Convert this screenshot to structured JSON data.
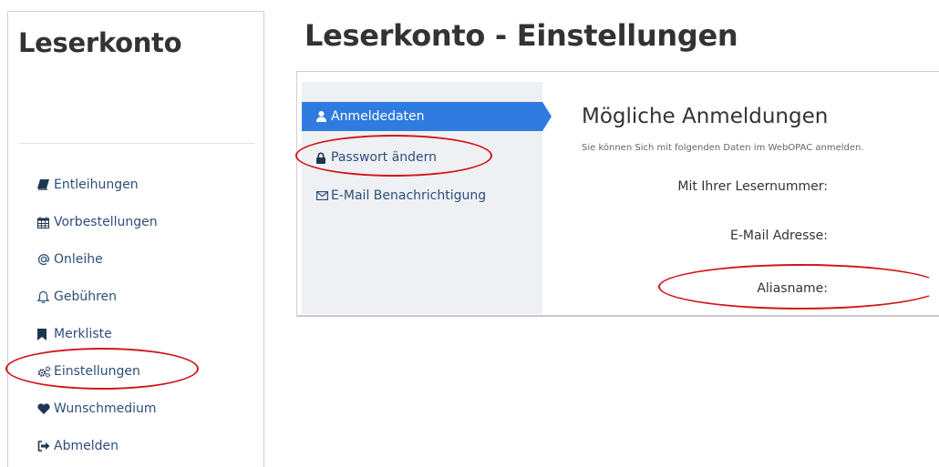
{
  "sidebar": {
    "title": "Leserkonto",
    "items": [
      {
        "label": "Entleihungen",
        "icon": "book-icon"
      },
      {
        "label": "Vorbestellungen",
        "icon": "calendar-icon"
      },
      {
        "label": "Onleihe",
        "icon": "at-icon"
      },
      {
        "label": "Gebühren",
        "icon": "bell-icon"
      },
      {
        "label": "Merkliste",
        "icon": "bookmark-icon"
      },
      {
        "label": "Einstellungen",
        "icon": "gears-icon"
      },
      {
        "label": "Wunschmedium",
        "icon": "heart-icon"
      },
      {
        "label": "Abmelden",
        "icon": "sign-out-icon"
      }
    ]
  },
  "main": {
    "title": "Leserkonto - Einstellungen",
    "tabs": [
      {
        "label": "Anmeldedaten",
        "icon": "user-icon",
        "active": true
      },
      {
        "label": "Passwort ändern",
        "icon": "lock-icon",
        "active": false
      },
      {
        "label": "E-Mail Benachrichtigung",
        "icon": "envelope-icon",
        "active": false
      }
    ],
    "content": {
      "heading": "Mögliche Anmeldungen",
      "description": "Sie können Sich mit folgenden Daten im WebOPAC anmelden.",
      "fields": [
        {
          "label": "Mit Ihrer Lesernummer:"
        },
        {
          "label": "E-Mail Adresse:"
        },
        {
          "label": "Aliasname:"
        }
      ]
    }
  },
  "colors": {
    "accent": "#2f7bdf",
    "link": "#2d4f7a",
    "annotation": "#d2141c",
    "nav_background": "#eef0f3"
  }
}
